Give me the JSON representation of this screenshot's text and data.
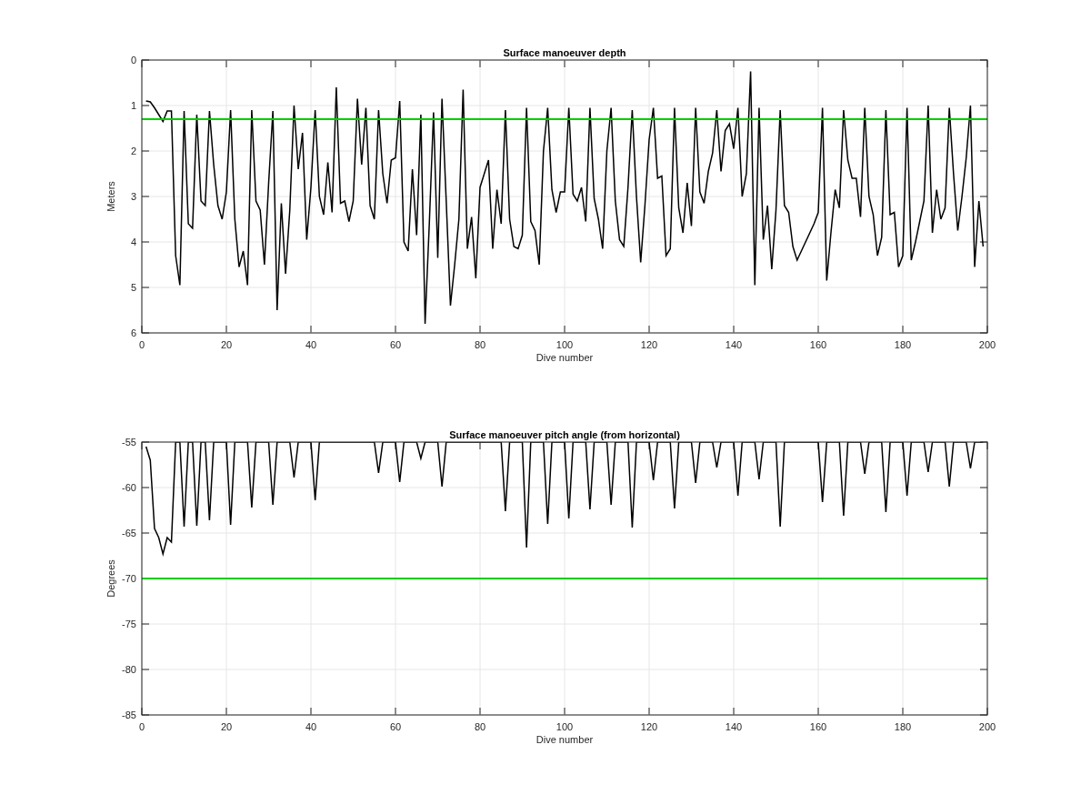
{
  "charts": [
    {
      "chart_data": {
        "type": "line",
        "title": "Surface manoeuver depth",
        "xlabel": "Dive number",
        "ylabel": "Meters",
        "grid": true,
        "xlim": [
          0,
          200
        ],
        "ylim": [
          6,
          0
        ],
        "xticks": [
          0,
          20,
          40,
          60,
          80,
          100,
          120,
          140,
          160,
          180,
          200
        ],
        "yticks": [
          0,
          1,
          2,
          3,
          4,
          5,
          6
        ],
        "x": [
          1,
          2,
          3,
          4,
          5,
          6,
          7,
          8,
          9,
          10,
          11,
          12,
          13,
          14,
          15,
          16,
          17,
          18,
          19,
          20,
          21,
          22,
          23,
          24,
          25,
          26,
          27,
          28,
          29,
          30,
          31,
          32,
          33,
          34,
          35,
          36,
          37,
          38,
          39,
          40,
          41,
          42,
          43,
          44,
          45,
          46,
          47,
          48,
          49,
          50,
          51,
          52,
          53,
          54,
          55,
          56,
          57,
          58,
          59,
          60,
          61,
          62,
          63,
          64,
          65,
          66,
          67,
          68,
          69,
          70,
          71,
          72,
          73,
          74,
          75,
          76,
          77,
          78,
          79,
          80,
          81,
          82,
          83,
          84,
          85,
          86,
          87,
          88,
          89,
          90,
          91,
          92,
          93,
          94,
          95,
          96,
          97,
          98,
          99,
          100,
          101,
          102,
          103,
          104,
          105,
          106,
          107,
          108,
          109,
          110,
          111,
          112,
          113,
          114,
          115,
          116,
          117,
          118,
          119,
          120,
          121,
          122,
          123,
          124,
          125,
          126,
          127,
          128,
          129,
          130,
          131,
          132,
          133,
          134,
          135,
          136,
          137,
          138,
          139,
          140,
          141,
          142,
          143,
          144,
          145,
          146,
          147,
          148,
          149,
          150,
          151,
          152,
          153,
          154,
          155,
          156,
          157,
          158,
          159,
          160,
          161,
          162,
          163,
          164,
          165,
          166,
          167,
          168,
          169,
          170,
          171,
          172,
          173,
          174,
          175,
          176,
          177,
          178,
          179,
          180,
          181,
          182,
          183,
          184,
          185,
          186,
          187,
          188,
          189,
          190,
          191,
          192,
          193,
          194,
          195,
          196,
          197,
          198,
          199
        ],
        "series": [
          {
            "color": "#000000",
            "values": [
              0.9,
              0.92,
              1.05,
              1.2,
              1.35,
              1.12,
              1.12,
              4.3,
              4.95,
              1.12,
              3.6,
              3.7,
              1.2,
              3.1,
              3.2,
              1.12,
              2.3,
              3.2,
              3.5,
              2.9,
              1.1,
              3.5,
              4.55,
              4.2,
              4.95,
              1.1,
              3.1,
              3.3,
              4.5,
              2.7,
              1.12,
              5.5,
              3.15,
              4.7,
              3.3,
              1.0,
              2.4,
              1.6,
              3.95,
              2.8,
              1.1,
              3.0,
              3.4,
              2.25,
              3.35,
              0.6,
              3.15,
              3.1,
              3.55,
              3.1,
              0.85,
              2.3,
              1.05,
              3.2,
              3.5,
              1.1,
              2.5,
              3.15,
              2.2,
              2.15,
              0.9,
              4.0,
              4.2,
              2.4,
              3.85,
              1.2,
              5.8,
              3.6,
              1.15,
              4.35,
              0.85,
              3.1,
              5.4,
              4.5,
              3.5,
              0.65,
              4.15,
              3.45,
              4.8,
              2.8,
              2.5,
              2.2,
              4.15,
              2.85,
              3.6,
              1.1,
              3.5,
              4.1,
              4.15,
              3.85,
              1.05,
              3.55,
              3.75,
              4.5,
              2.0,
              1.05,
              2.85,
              3.35,
              2.9,
              2.9,
              1.05,
              2.95,
              3.1,
              2.8,
              3.55,
              1.05,
              3.05,
              3.5,
              4.15,
              2.0,
              1.05,
              3.1,
              3.95,
              4.1,
              2.8,
              1.1,
              3.0,
              4.45,
              3.2,
              1.75,
              1.05,
              2.6,
              2.55,
              4.3,
              4.15,
              1.05,
              3.25,
              3.8,
              2.7,
              3.65,
              1.05,
              2.9,
              3.15,
              2.45,
              2.05,
              1.1,
              2.45,
              1.55,
              1.4,
              1.95,
              1.05,
              3.0,
              2.5,
              0.25,
              4.95,
              1.05,
              3.95,
              3.2,
              4.6,
              3.3,
              1.1,
              3.2,
              3.35,
              4.1,
              4.4,
              4.2,
              4.0,
              3.8,
              3.6,
              3.35,
              1.05,
              4.85,
              3.8,
              2.85,
              3.25,
              1.1,
              2.2,
              2.6,
              2.6,
              3.45,
              1.05,
              3.0,
              3.4,
              4.3,
              3.9,
              1.1,
              3.4,
              3.35,
              4.55,
              4.3,
              1.05,
              4.4,
              4.0,
              3.55,
              3.1,
              1.0,
              3.8,
              2.85,
              3.5,
              3.25,
              1.05,
              2.5,
              3.75,
              3.0,
              2.15,
              1.0,
              4.55,
              3.1,
              4.1
            ]
          }
        ],
        "ref_lines": [
          {
            "axis": "y",
            "value": 1.3,
            "color": "#00cc00"
          }
        ]
      }
    },
    {
      "chart_data": {
        "type": "line",
        "title": "Surface manoeuver pitch angle (from horizontal)",
        "xlabel": "Dive number",
        "ylabel": "Degrees",
        "grid": true,
        "xlim": [
          0,
          200
        ],
        "ylim": [
          -85,
          -55
        ],
        "xticks": [
          0,
          20,
          40,
          60,
          80,
          100,
          120,
          140,
          160,
          180,
          200
        ],
        "yticks": [
          -85,
          -80,
          -75,
          -70,
          -65,
          -60,
          -55
        ],
        "x": [
          1,
          2,
          3,
          4,
          5,
          6,
          7,
          8,
          9,
          10,
          11,
          12,
          13,
          14,
          15,
          16,
          17,
          18,
          19,
          20,
          21,
          22,
          23,
          24,
          25,
          26,
          27,
          28,
          29,
          30,
          31,
          32,
          33,
          34,
          35,
          36,
          37,
          38,
          39,
          40,
          41,
          42,
          43,
          44,
          45,
          46,
          47,
          48,
          49,
          50,
          51,
          52,
          53,
          54,
          55,
          56,
          57,
          58,
          59,
          60,
          61,
          62,
          63,
          64,
          65,
          66,
          67,
          68,
          69,
          70,
          71,
          72,
          73,
          74,
          75,
          76,
          77,
          78,
          79,
          80,
          81,
          82,
          83,
          84,
          85,
          86,
          87,
          88,
          89,
          90,
          91,
          92,
          93,
          94,
          95,
          96,
          97,
          98,
          99,
          100,
          101,
          102,
          103,
          104,
          105,
          106,
          107,
          108,
          109,
          110,
          111,
          112,
          113,
          114,
          115,
          116,
          117,
          118,
          119,
          120,
          121,
          122,
          123,
          124,
          125,
          126,
          127,
          128,
          129,
          130,
          131,
          132,
          133,
          134,
          135,
          136,
          137,
          138,
          139,
          140,
          141,
          142,
          143,
          144,
          145,
          146,
          147,
          148,
          149,
          150,
          151,
          152,
          153,
          154,
          155,
          156,
          157,
          158,
          159,
          160,
          161,
          162,
          163,
          164,
          165,
          166,
          167,
          168,
          169,
          170,
          171,
          172,
          173,
          174,
          175,
          176,
          177,
          178,
          179,
          180,
          181,
          182,
          183,
          184,
          185,
          186,
          187,
          188,
          189,
          190,
          191,
          192,
          193,
          194,
          195,
          196,
          197,
          198,
          199
        ],
        "series": [
          {
            "color": "#000000",
            "values": [
              -55.5,
              -57,
              -64.5,
              -65.5,
              -67.3,
              -65.5,
              -66,
              -55,
              -55,
              -64.3,
              -55,
              -55,
              -64.2,
              -55,
              -55,
              -63.6,
              -55,
              -55,
              -55,
              -55,
              -64.1,
              -55,
              -55,
              -55,
              -55,
              -62.2,
              -55,
              -55,
              -55,
              -55,
              -61.9,
              -55,
              -55,
              -55,
              -55,
              -58.9,
              -55,
              -55,
              -55,
              -55,
              -61.4,
              -55,
              -55,
              -55,
              -55,
              -55,
              -55,
              -55,
              -55,
              -55,
              -55,
              -55,
              -55,
              -55,
              -55,
              -58.4,
              -55,
              -55,
              -55,
              -55,
              -59.4,
              -55,
              -55,
              -55,
              -55,
              -56.8,
              -55,
              -55,
              -55,
              -55,
              -59.9,
              -55,
              -55,
              -55,
              -55,
              -55,
              -55,
              -55,
              -55,
              -55,
              -55,
              -55,
              -55,
              -55,
              -55,
              -62.6,
              -55,
              -55,
              -55,
              -55,
              -66.6,
              -55,
              -55,
              -55,
              -55,
              -64,
              -55,
              -55,
              -55,
              -55,
              -63.4,
              -55,
              -55,
              -55,
              -55,
              -62.4,
              -55,
              -55,
              -55,
              -55,
              -61.9,
              -55,
              -55,
              -55,
              -55,
              -64.4,
              -55,
              -55,
              -55,
              -55,
              -59.2,
              -55,
              -55,
              -55,
              -55,
              -62.3,
              -55,
              -55,
              -55,
              -55,
              -59.5,
              -55,
              -55,
              -55,
              -55,
              -57.8,
              -55,
              -55,
              -55,
              -55,
              -60.9,
              -55,
              -55,
              -55,
              -55,
              -59.1,
              -55,
              -55,
              -55,
              -55,
              -64.3,
              -55,
              -55,
              -55,
              -55,
              -55,
              -55,
              -55,
              -55,
              -55,
              -61.6,
              -55,
              -55,
              -55,
              -55,
              -63.1,
              -55,
              -55,
              -55,
              -55,
              -58.5,
              -55,
              -55,
              -55,
              -55,
              -62.7,
              -55,
              -55,
              -55,
              -55,
              -60.9,
              -55,
              -55,
              -55,
              -55,
              -58.3,
              -55,
              -55,
              -55,
              -55,
              -59.9,
              -55,
              -55,
              -55,
              -55,
              -57.9,
              -55,
              -55,
              -55
            ]
          }
        ],
        "ref_lines": [
          {
            "axis": "y",
            "value": -70,
            "color": "#00cc00"
          }
        ]
      }
    }
  ]
}
